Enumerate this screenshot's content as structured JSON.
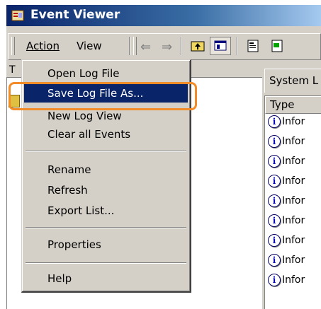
{
  "window": {
    "title": "Event Viewer"
  },
  "menubar": {
    "action_label": "Action",
    "view_label": "View"
  },
  "toolbar_icons": [
    "back-arrow-icon",
    "forward-arrow-icon",
    "up-folder-icon",
    "show-hide-tree-icon",
    "properties-icon"
  ],
  "left_panel": {
    "header_fragment": "T"
  },
  "right_panel": {
    "tab_label": "System L",
    "column_header": "Type",
    "rows": [
      "Infor",
      "Infor",
      "Infor",
      "Infor",
      "Infor",
      "Infor",
      "Infor",
      "Infor",
      "Infor"
    ]
  },
  "menu": {
    "items": [
      {
        "label": "Open Log File"
      },
      {
        "label": "Save Log File As..."
      },
      {
        "label": "New Log View"
      },
      {
        "label": "Clear all Events"
      },
      {
        "label": "Rename"
      },
      {
        "label": "Refresh"
      },
      {
        "label": "Export List..."
      },
      {
        "label": "Properties"
      },
      {
        "label": "Help"
      }
    ],
    "selected_index": 1
  },
  "colors": {
    "title_bar": "#0a246a",
    "menu_selection": "#0a246a",
    "highlight_ring": "#f28c28",
    "window_face": "#d4d0c8"
  }
}
